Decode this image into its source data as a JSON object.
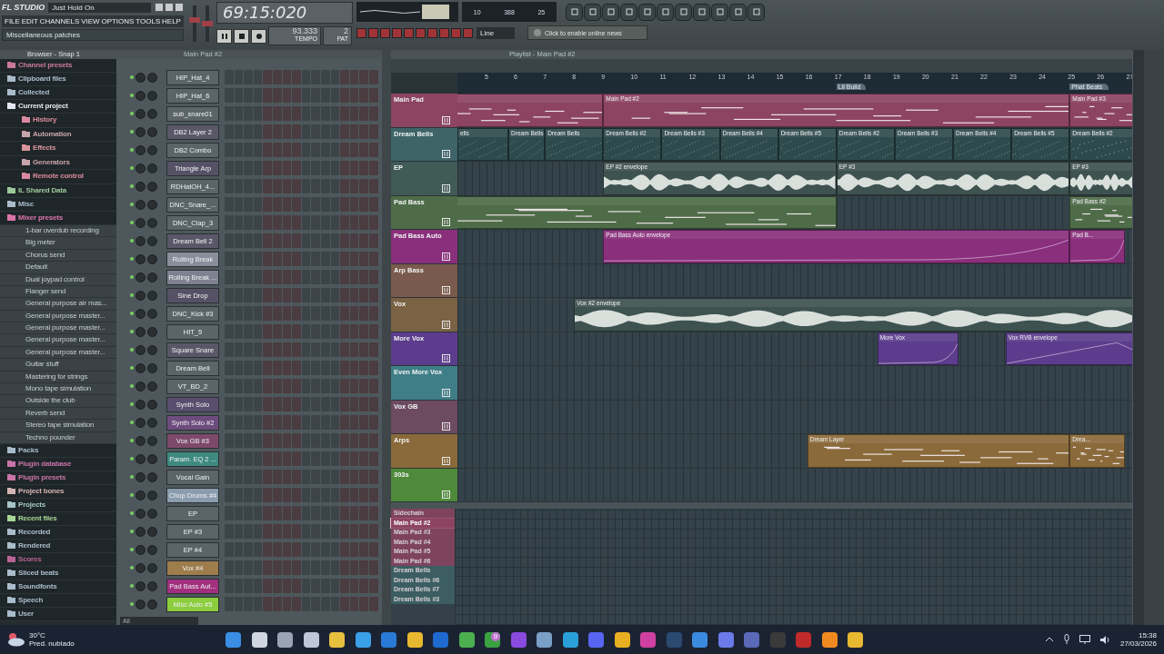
{
  "app": {
    "logo": "FL STUDIO",
    "song_title": "Just Hold On",
    "menu": [
      "FILE",
      "EDIT",
      "CHANNELS",
      "VIEW",
      "OPTIONS",
      "TOOLS",
      "HELP"
    ],
    "hint": "Miscellaneous patches",
    "time": "69:15:020",
    "tempo": "93.333",
    "tempo_label": "TEMPO",
    "pattern": "2",
    "pattern_label": "PAT",
    "snap": "Line",
    "cpu": "10",
    "memory": "388",
    "polyphony": "25",
    "news": "Click to enable online news",
    "master_volume": {
      "level": 0.62
    },
    "master_pitch": {
      "level": 0.5
    }
  },
  "browser": {
    "title": "Browser - Snap 1",
    "items": [
      {
        "label": "Channel presets",
        "kind": "folder",
        "color": "#c97a9a"
      },
      {
        "label": "Clipboard files",
        "kind": "folder",
        "color": "#a9bccb"
      },
      {
        "label": "Collected",
        "kind": "folder",
        "color": "#a9bccb"
      },
      {
        "label": "Current project",
        "kind": "folder",
        "color": "#e4e6f2"
      },
      {
        "label": "History",
        "kind": "subfolder",
        "color": "#d98a9e"
      },
      {
        "label": "Automation",
        "kind": "subfolder",
        "color": "#c9a4a8"
      },
      {
        "label": "Effects",
        "kind": "subfolder",
        "color": "#d9949c"
      },
      {
        "label": "Generators",
        "kind": "subfolder",
        "color": "#c9a4a8"
      },
      {
        "label": "Remote control",
        "kind": "subfolder",
        "color": "#d98a9e"
      },
      {
        "label": "IL Shared Data",
        "kind": "folder",
        "color": "#9cc89c"
      },
      {
        "label": "Misc",
        "kind": "folder",
        "color": "#a9bccb"
      },
      {
        "label": "Mixer presets",
        "kind": "folder",
        "color": "#dc74a8"
      },
      {
        "label": "1-bar overdub recording",
        "kind": "preset"
      },
      {
        "label": "Big meter",
        "kind": "preset"
      },
      {
        "label": "Chorus send",
        "kind": "preset"
      },
      {
        "label": "Default",
        "kind": "preset"
      },
      {
        "label": "Dual joypad control",
        "kind": "preset"
      },
      {
        "label": "Flanger send",
        "kind": "preset"
      },
      {
        "label": "General purpose air mas...",
        "kind": "preset"
      },
      {
        "label": "General purpose master...",
        "kind": "preset"
      },
      {
        "label": "General purpose master...",
        "kind": "preset"
      },
      {
        "label": "General purpose master...",
        "kind": "preset"
      },
      {
        "label": "General purpose master...",
        "kind": "preset"
      },
      {
        "label": "Guitar stuff",
        "kind": "preset"
      },
      {
        "label": "Mastering for strings",
        "kind": "preset"
      },
      {
        "label": "Mono tape simulation",
        "kind": "preset"
      },
      {
        "label": "Outside the club",
        "kind": "preset"
      },
      {
        "label": "Reverb send",
        "kind": "preset"
      },
      {
        "label": "Stereo tape simulation",
        "kind": "preset"
      },
      {
        "label": "Techno pounder",
        "kind": "preset"
      },
      {
        "label": "Packs",
        "kind": "folder",
        "color": "#a9bccb"
      },
      {
        "label": "Plugin database",
        "kind": "folder",
        "color": "#c874a8"
      },
      {
        "label": "Plugin presets",
        "kind": "folder",
        "color": "#c874a8"
      },
      {
        "label": "Project bones",
        "kind": "folder",
        "color": "#d6b4b4"
      },
      {
        "label": "Projects",
        "kind": "folder",
        "color": "#a4c6c6"
      },
      {
        "label": "Recent files",
        "kind": "folder",
        "color": "#a6d694"
      },
      {
        "label": "Recorded",
        "kind": "folder",
        "color": "#a9bccb"
      },
      {
        "label": "Rendered",
        "kind": "folder",
        "color": "#a9bccb"
      },
      {
        "label": "Scores",
        "kind": "folder",
        "color": "#b86494"
      },
      {
        "label": "Sliced beats",
        "kind": "folder",
        "color": "#a9bccb"
      },
      {
        "label": "Soundfonts",
        "kind": "folder",
        "color": "#a9bccb"
      },
      {
        "label": "Speech",
        "kind": "folder",
        "color": "#a9bccb"
      },
      {
        "label": "User",
        "kind": "folder",
        "color": "#a9bccb"
      }
    ]
  },
  "channel_rack": {
    "title": "Main Pad #2",
    "filter": "All",
    "channels": [
      {
        "name": "HIP_Hat_4",
        "color": "#5b6468"
      },
      {
        "name": "HIP_Hat_6",
        "color": "#5b6468"
      },
      {
        "name": "sub_snare01",
        "color": "#5b6468"
      },
      {
        "name": "DB2 Layer 2",
        "color": "#5a5868"
      },
      {
        "name": "DB2 Combo",
        "color": "#5b6468"
      },
      {
        "name": "Triangle Arp",
        "color": "#565266"
      },
      {
        "name": "RDHatOH_4...",
        "color": "#5b6468"
      },
      {
        "name": "DNC_Snare_...",
        "color": "#5b6468"
      },
      {
        "name": "DNC_Clap_3",
        "color": "#5b6468"
      },
      {
        "name": "Dream Bell 2",
        "color": "#5a5868"
      },
      {
        "name": "Rolling Break",
        "color": "#8a8e9c"
      },
      {
        "name": "Rolling Break ...",
        "color": "#7e8290"
      },
      {
        "name": "Sine Drop",
        "color": "#565266"
      },
      {
        "name": "DNC_Kick #3",
        "color": "#5b6468"
      },
      {
        "name": "HIT_5",
        "color": "#5b6468"
      },
      {
        "name": "Square Snare",
        "color": "#5a5868"
      },
      {
        "name": "Dream Bell",
        "color": "#5b6468"
      },
      {
        "name": "VT_BD_2",
        "color": "#5b6468"
      },
      {
        "name": "Synth Solo",
        "color": "#5a4e6e"
      },
      {
        "name": "Synth Solo #2",
        "color": "#6e4c7e"
      },
      {
        "name": "Vox GB #3",
        "color": "#7e4a6c"
      },
      {
        "name": "Param. EQ 2 ...",
        "color": "#3f8a80"
      },
      {
        "name": "Vocal Gain",
        "color": "#5b6468"
      },
      {
        "name": "Chop Drums #4",
        "color": "#8a9cae"
      },
      {
        "name": "EP",
        "color": "#5b6468"
      },
      {
        "name": "EP #3",
        "color": "#5b6468"
      },
      {
        "name": "EP #4",
        "color": "#5b6468"
      },
      {
        "name": "Vox #4",
        "color": "#9e7c4c"
      },
      {
        "name": "Pad Bass Aut...",
        "color": "#a2307f"
      },
      {
        "name": "Misc Auto #5",
        "color": "#8cce3e"
      }
    ]
  },
  "playlist": {
    "title": "Playlist - Main Pad #2",
    "bars": [
      "5",
      "6",
      "7",
      "8",
      "9",
      "10",
      "11",
      "12",
      "13",
      "14",
      "15",
      "16",
      "17",
      "18",
      "19",
      "20",
      "21",
      "22",
      "23",
      "24",
      "25",
      "26",
      "27"
    ],
    "markers": [
      "Lil Build",
      "Phat Beats"
    ],
    "tracks": [
      {
        "name": "Main Pad",
        "color": "#8c4462",
        "clips": [
          {
            "kind": "notes"
          },
          {
            "label": "Main Pad #2",
            "kind": "notes"
          },
          {
            "label": "Main Pad #3",
            "kind": "notes"
          }
        ]
      },
      {
        "name": "Dream Bells",
        "color": "#3e6468",
        "clips": [
          {
            "label": "ells",
            "kind": "dots"
          },
          {
            "label": "Dream Bells",
            "kind": "dots"
          },
          {
            "label": "Dream Bells",
            "kind": "dots"
          },
          {
            "label": "Dream Bells #2",
            "kind": "dots"
          },
          {
            "label": "Dream Bells #3",
            "kind": "dots"
          },
          {
            "label": "Dream Bells #4",
            "kind": "dots"
          },
          {
            "label": "Dream Bells #5",
            "kind": "dots"
          },
          {
            "label": "Dream Bells #2",
            "kind": "dots"
          },
          {
            "label": "Dream Bells #3",
            "kind": "dots"
          },
          {
            "label": "Dream Bells #4",
            "kind": "dots"
          },
          {
            "label": "Dream Bells #5",
            "kind": "dots"
          },
          {
            "label": "Dream Bells #2",
            "kind": "dots"
          }
        ]
      },
      {
        "name": "EP",
        "color": "#405a56",
        "clips": [
          {
            "label": "EP #2 envelope",
            "kind": "audio"
          },
          {
            "label": "EP #3",
            "kind": "audio"
          },
          {
            "label": "EP #3",
            "kind": "audio"
          }
        ]
      },
      {
        "name": "Pad Bass",
        "color": "#4e6c48",
        "clips": [
          {
            "kind": "notes"
          },
          {
            "label": "Pad Bass #2",
            "kind": "notes"
          }
        ]
      },
      {
        "name": "Pad Bass Auto",
        "color": "#8a2f7c",
        "clips": [
          {
            "label": "Pad Bass Auto envelope",
            "kind": "automation"
          },
          {
            "label": "Pad B...",
            "kind": "automation"
          }
        ]
      },
      {
        "name": "Arp Bass",
        "color": "#7a5a4c"
      },
      {
        "name": "Vox",
        "color": "#7a6244",
        "clips": [
          {
            "label": "Vox #2 envelope",
            "kind": "audio"
          }
        ]
      },
      {
        "name": "More Vox",
        "color": "#5c3c8c",
        "clips": [
          {
            "label": "More Vox",
            "kind": "automation"
          },
          {
            "label": "Vox RVB envelope",
            "kind": "automation"
          }
        ]
      },
      {
        "name": "Even More Vox",
        "color": "#3f7e86"
      },
      {
        "name": "Vox GB",
        "color": "#6c4a60"
      },
      {
        "name": "Arps",
        "color": "#8a6a3a",
        "clips": [
          {
            "label": "Dream Layer",
            "kind": "notes"
          },
          {
            "label": "Drea...",
            "kind": "notes"
          }
        ]
      },
      {
        "name": "303s",
        "color": "#4e8a3a"
      }
    ],
    "patterns": [
      {
        "name": "Sidechain",
        "color": "#8c4462",
        "selected": false
      },
      {
        "name": "Main Pad #2",
        "color": "#8c4462",
        "selected": true
      },
      {
        "name": "Main Pad #3",
        "color": "#8c4462",
        "selected": false
      },
      {
        "name": "Main Pad #4",
        "color": "#8c4462",
        "selected": false
      },
      {
        "name": "Main Pad #5",
        "color": "#8c4462",
        "selected": false
      },
      {
        "name": "Main Pad #6",
        "color": "#8c4462",
        "selected": false
      },
      {
        "name": "Dream Bells",
        "color": "#3e6468",
        "selected": false
      },
      {
        "name": "Dream Bells #6",
        "color": "#3e6468",
        "selected": false
      },
      {
        "name": "Dream Bells #7",
        "color": "#3e6468",
        "selected": false
      },
      {
        "name": "Dream Bells #3",
        "color": "#3e6468",
        "selected": false
      }
    ]
  },
  "taskbar": {
    "temperature": "30°C",
    "forecast": "Pred. nublado",
    "badge": "9",
    "time": "15:38",
    "date": "27/03/2026"
  }
}
